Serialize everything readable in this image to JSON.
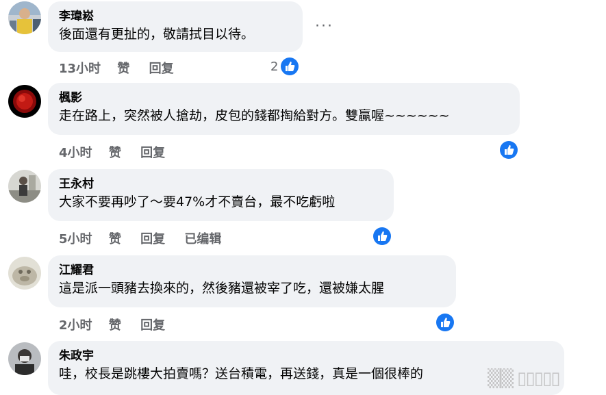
{
  "comments": [
    {
      "name": "李瑋崧",
      "text": "後面還有更扯的，敬請拭目以待。",
      "time": "13小时",
      "like": "赞",
      "reply": "回复",
      "reaction_count": "2",
      "more": "···"
    },
    {
      "name": "楓影",
      "text": "走在路上，突然被人搶劫，皮包的錢都掏給對方。雙贏喔~~~~~~",
      "time": "4小时",
      "like": "赞",
      "reply": "回复"
    },
    {
      "name": "王永村",
      "text": "大家不要再吵了～要47%才不賣台，最不吃虧啦",
      "time": "5小时",
      "like": "赞",
      "reply": "回复",
      "edited": "已编辑"
    },
    {
      "name": "江耀君",
      "text": "這是派一頭豬去換來的，然後豬還被宰了吃，還被嫌太腥",
      "time": "2小时",
      "like": "赞",
      "reply": "回复"
    },
    {
      "name": "朱政宇",
      "text": "哇，校長是跳樓大拍賣嗎？送台積電，再送錢，真是一個很棒的",
      "time": "",
      "like": "",
      "reply": ""
    }
  ],
  "colors": {
    "bubble": "#f0f2f5",
    "like_blue": "#1877f2",
    "meta_gray": "#65676b"
  },
  "icons": [
    "like-thumb-icon",
    "more-options-icon"
  ]
}
